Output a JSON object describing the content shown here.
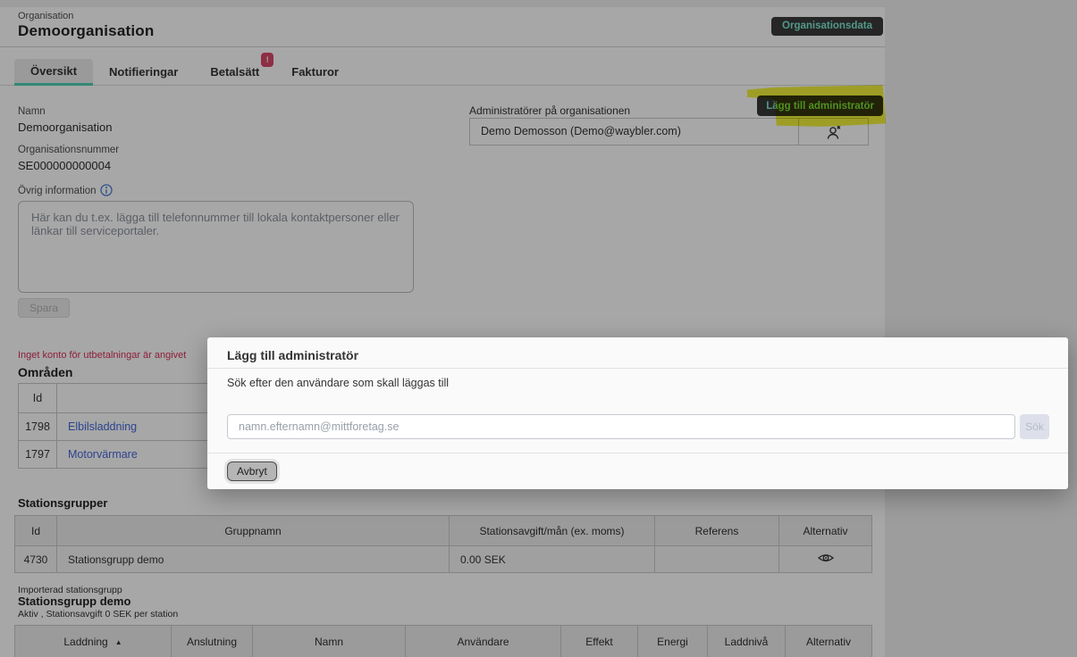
{
  "header": {
    "breadcrumb": "Organisation",
    "title": "Demoorganisation",
    "org_data_button": "Organisationsdata"
  },
  "tabs": [
    {
      "label": "Översikt",
      "active": true
    },
    {
      "label": "Notifieringar",
      "active": false
    },
    {
      "label": "Betalsätt",
      "active": false,
      "badge": "!"
    },
    {
      "label": "Fakturor",
      "active": false
    }
  ],
  "details": {
    "name_label": "Namn",
    "name_value": "Demoorganisation",
    "orgnr_label": "Organisationsnummer",
    "orgnr_value": "SE000000000004",
    "info_label": "Övrig information",
    "info_placeholder": "Här kan du t.ex. lägga till telefonnummer till lokala kontaktpersoner eller länkar till serviceportaler.",
    "save_label": "Spara"
  },
  "admins": {
    "label": "Administratörer på organisationen",
    "add_button": "Lägg till administratör",
    "rows": [
      {
        "name": "Demo Demosson (Demo@waybler.com)"
      }
    ]
  },
  "alerts": {
    "no_payout_account": "Inget konto för utbetalningar är angivet"
  },
  "areas": {
    "title": "Områden",
    "headers": [
      "Id"
    ],
    "rows": [
      {
        "id": "1798",
        "name": "Elbilsladdning"
      },
      {
        "id": "1797",
        "name": "Motorvärmare"
      }
    ]
  },
  "station_groups": {
    "title": "Stationsgrupper",
    "headers": [
      "Id",
      "Gruppnamn",
      "Stationsavgift/mån (ex. moms)",
      "Referens",
      "Alternativ"
    ],
    "rows": [
      {
        "id": "4730",
        "name": "Stationsgrupp demo",
        "fee": "0.00 SEK",
        "reference": ""
      }
    ]
  },
  "imported_group": {
    "label": "Importerad stationsgrupp",
    "name": "Stationsgrupp demo",
    "status": "Aktiv , Stationsavgift 0 SEK per station",
    "headers": [
      "Laddning",
      "Anslutning",
      "Namn",
      "Användare",
      "Effekt",
      "Energi",
      "Laddnivå",
      "Alternativ"
    ]
  },
  "modal": {
    "title": "Lägg till administratör",
    "search_label": "Sök efter den användare som skall läggas till",
    "input_placeholder": "namn.efternamn@mittforetag.se",
    "search_button": "Sök",
    "cancel_button": "Avbryt"
  },
  "colors": {
    "accent_teal": "#4fd0b5",
    "dark_button": "#3a3a3a",
    "dark_button_text": "#7fe8d0",
    "badge_red": "#d8486a",
    "link_blue": "#4468d9",
    "alert_red": "#d8305a",
    "highlight_yellow": "#f1f13a"
  }
}
